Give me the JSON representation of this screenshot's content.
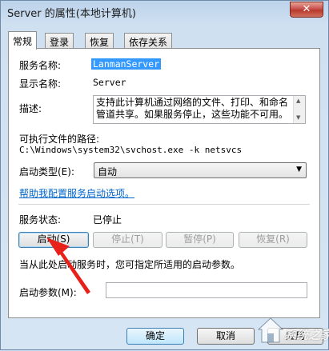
{
  "window": {
    "title": "Server 的属性(本地计算机)",
    "close_label": "✕"
  },
  "tabs": [
    {
      "label": "常规",
      "active": true
    },
    {
      "label": "登录",
      "active": false
    },
    {
      "label": "恢复",
      "active": false
    },
    {
      "label": "依存关系",
      "active": false
    }
  ],
  "general": {
    "service_name_label": "服务名称:",
    "service_name_value": "LanmanServer",
    "display_name_label": "显示名称:",
    "display_name_value": "Server",
    "description_label": "描述:",
    "description_value": "支持此计算机通过网络的文件、打印、和命名管道共享。如果服务停止，这些功能不可用。",
    "exe_path_label": "可执行文件的路径:",
    "exe_path_value": "C:\\Windows\\system32\\svchost.exe -k netsvcs",
    "startup_type_label": "启动类型(E):",
    "startup_type_value": "自动",
    "help_link": "帮助我配置服务启动选项。",
    "status_label": "服务状态:",
    "status_value": "已停止",
    "buttons": {
      "start": "启动(S)",
      "stop": "停止(T)",
      "pause": "暂停(P)",
      "resume": "恢复(R)"
    },
    "hint": "当从此处启动服务时，您可指定所适用的启动参数。",
    "start_params_label": "启动参数(M):",
    "start_params_value": ""
  },
  "footer": {
    "ok": "确定",
    "cancel": "取消",
    "apply": "应用"
  },
  "watermark": {
    "text": "系统之家"
  },
  "colors": {
    "annotation_arrow": "#e8201a",
    "selection": "#3399ff",
    "link": "#0066cc"
  }
}
